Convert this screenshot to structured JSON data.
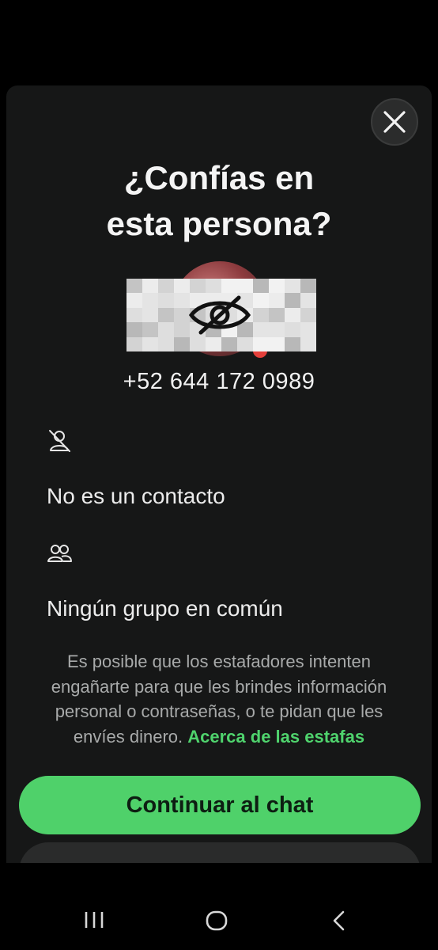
{
  "dialog": {
    "title_line1": "¿Confías en",
    "title_line2": "esta persona?",
    "phone_number": "+52 644 172 0989",
    "not_contact_label": "No es un contacto",
    "no_groups_label": "Ningún grupo en común",
    "description": "Es posible que los estafadores intenten engañarte para que les brindes información personal o contraseñas, o te pidan que les envíes dinero.",
    "description_link": "Acerca de las estafas",
    "continue_label": "Continuar al chat"
  },
  "icons": {
    "close": "close-icon",
    "hidden_avatar": "eye-off-icon",
    "not_contact": "person-off-icon",
    "groups": "group-icon",
    "nav_recent": "recent-apps-icon",
    "nav_home": "home-icon",
    "nav_back": "back-icon"
  },
  "colors": {
    "accent": "#4fd16a",
    "link": "#4fd36d",
    "sheet_background": "#161717"
  }
}
